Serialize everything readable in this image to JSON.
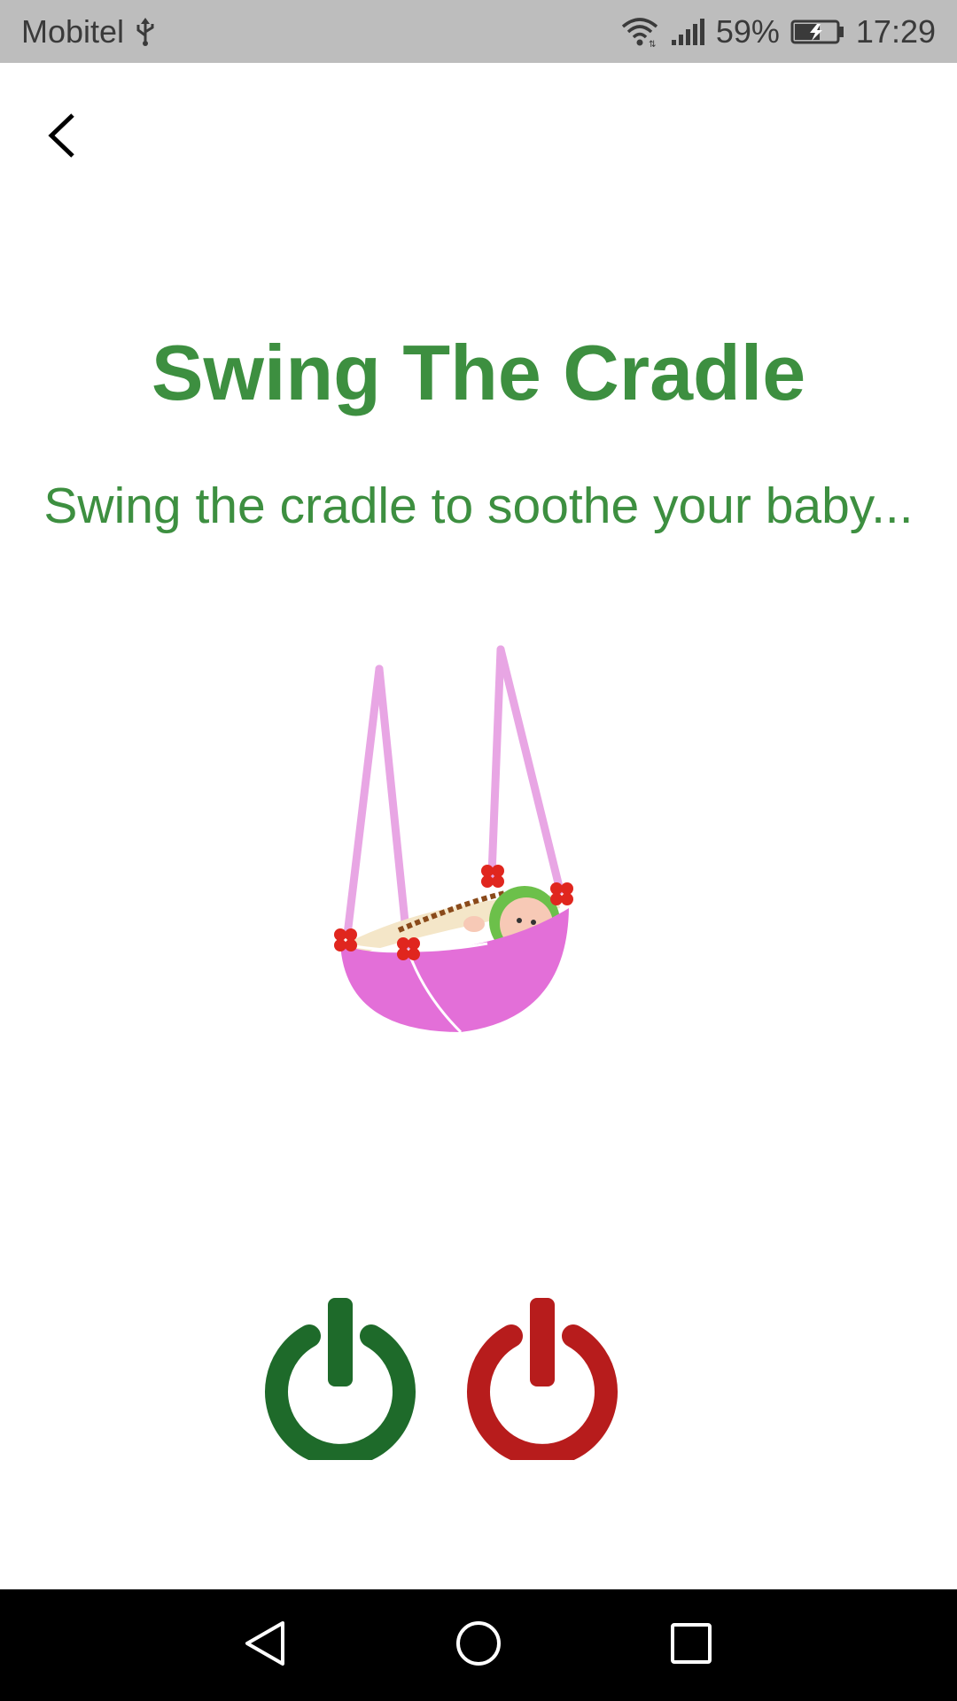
{
  "status_bar": {
    "carrier": "Mobitel",
    "battery_percent": "59%",
    "time": "17:29",
    "icons": [
      "usb-icon",
      "wifi-icon",
      "signal-icon",
      "battery-charging-icon"
    ]
  },
  "header": {
    "back_icon": "chevron-left-icon"
  },
  "main": {
    "title": "Swing The Cradle",
    "subtitle": "Swing the cradle to soothe your baby...",
    "image": "cradle-illustration",
    "buttons": [
      {
        "icon": "power-icon",
        "color": "#1e6a2a"
      },
      {
        "icon": "power-icon",
        "color": "#b71c1c"
      }
    ]
  },
  "nav_bar": {
    "icons": [
      "nav-back-icon",
      "nav-home-icon",
      "nav-recents-icon"
    ]
  },
  "colors": {
    "accent_green": "#3d8f40",
    "start_green": "#1e6a2a",
    "stop_red": "#b71c1c",
    "cradle_pink": "#e36fd8",
    "rope_pink": "#e8a6e4"
  }
}
